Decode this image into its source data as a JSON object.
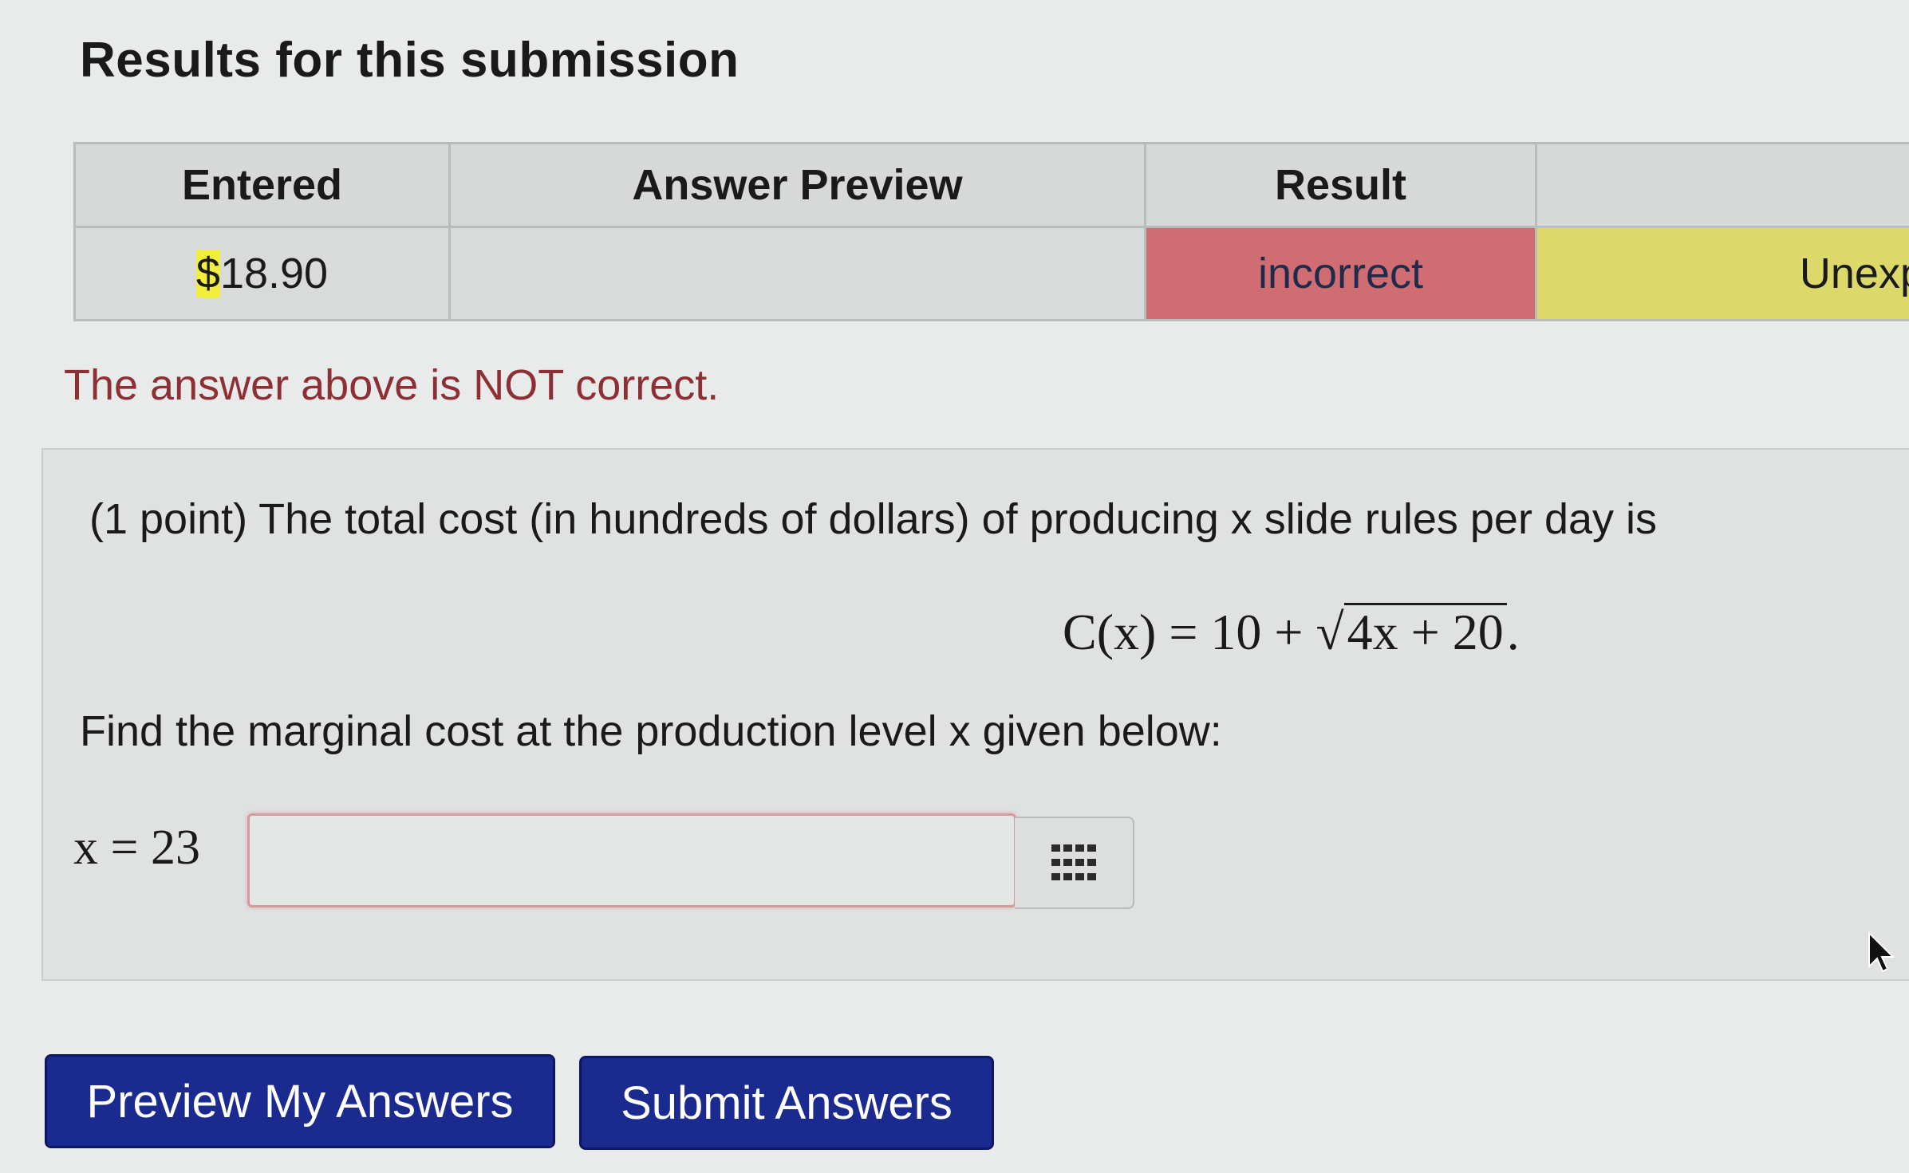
{
  "heading": "Results for this submission",
  "results_table": {
    "headers": [
      "Entered",
      "Answer Preview",
      "Result",
      ""
    ],
    "row": {
      "entered_symbol": "$",
      "entered_value": "18.90",
      "preview": "",
      "result": "incorrect",
      "message": "Unexp"
    }
  },
  "status_message": "The answer above is NOT correct.",
  "problem": {
    "statement": "(1 point) The total cost (in hundreds of dollars) of producing x slide rules per day is",
    "formula_lhs": "C(x) = 10 + ",
    "formula_radicand": "4x + 20",
    "formula_end": ".",
    "instruction": "Find the marginal cost at the production level x given below:",
    "input_label": "x = 23",
    "input_value": ""
  },
  "buttons": {
    "preview": "Preview My Answers",
    "submit": "Submit Answers"
  },
  "colors": {
    "incorrect_bg": "#cf6d72",
    "message_bg": "#dcd86a",
    "button_bg": "#1b2a8e",
    "error_text": "#8e2f35"
  },
  "icons": {
    "palette": "grid-icon",
    "radical": "square-root-sign",
    "pointer": "mouse-cursor-icon"
  }
}
